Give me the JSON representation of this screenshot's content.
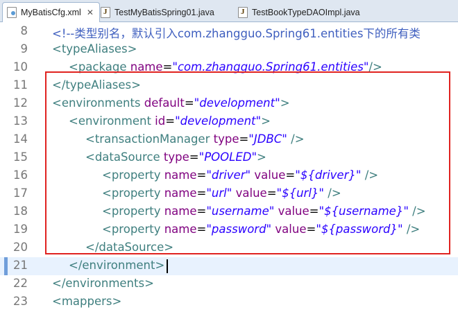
{
  "tabs": [
    {
      "label": "MyBatisCfg.xml",
      "icon": "xml-file-icon",
      "active": true,
      "close": "✕"
    },
    {
      "label": "TestMyBatisSpring01.java",
      "icon": "java-file-icon",
      "active": false
    },
    {
      "label": "TestBookTypeDAOImpl.java",
      "icon": "java-file-icon",
      "active": false
    }
  ],
  "lines": [
    {
      "n": "8",
      "s": "<!--类型别名，默认引入com.zhangguo.Spring61.entities下的所有类"
    },
    {
      "n": "9",
      "s": "<typeAliases>"
    },
    {
      "n": "10",
      "s": "<package name=\"com.zhangguo.Spring61.entities\"/>"
    },
    {
      "n": "11",
      "s": "</typeAliases>"
    },
    {
      "n": "12",
      "s": "<environments default=\"development\">"
    },
    {
      "n": "13",
      "s": "<environment id=\"development\">"
    },
    {
      "n": "14",
      "s": "<transactionManager type=\"JDBC\" />"
    },
    {
      "n": "15",
      "s": "<dataSource type=\"POOLED\">"
    },
    {
      "n": "16",
      "s": "<property name=\"driver\" value=\"${driver}\" />"
    },
    {
      "n": "17",
      "s": "<property name=\"url\" value=\"${url}\" />"
    },
    {
      "n": "18",
      "s": "<property name=\"username\" value=\"${username}\" />"
    },
    {
      "n": "19",
      "s": "<property name=\"password\" value=\"${password}\" />"
    },
    {
      "n": "20",
      "s": "</dataSource>"
    },
    {
      "n": "21",
      "s": "</environment>"
    },
    {
      "n": "22",
      "s": "</environments>"
    },
    {
      "n": "23",
      "s": "<mappers>"
    }
  ],
  "current_line": "21",
  "colors": {
    "tag": "#3f7f7f",
    "attr": "#7f007f",
    "value": "#2a00ff",
    "comment": "#3f5fbf",
    "highlight_box": "#e0221f",
    "current_line_bg": "#e8f2fe"
  }
}
